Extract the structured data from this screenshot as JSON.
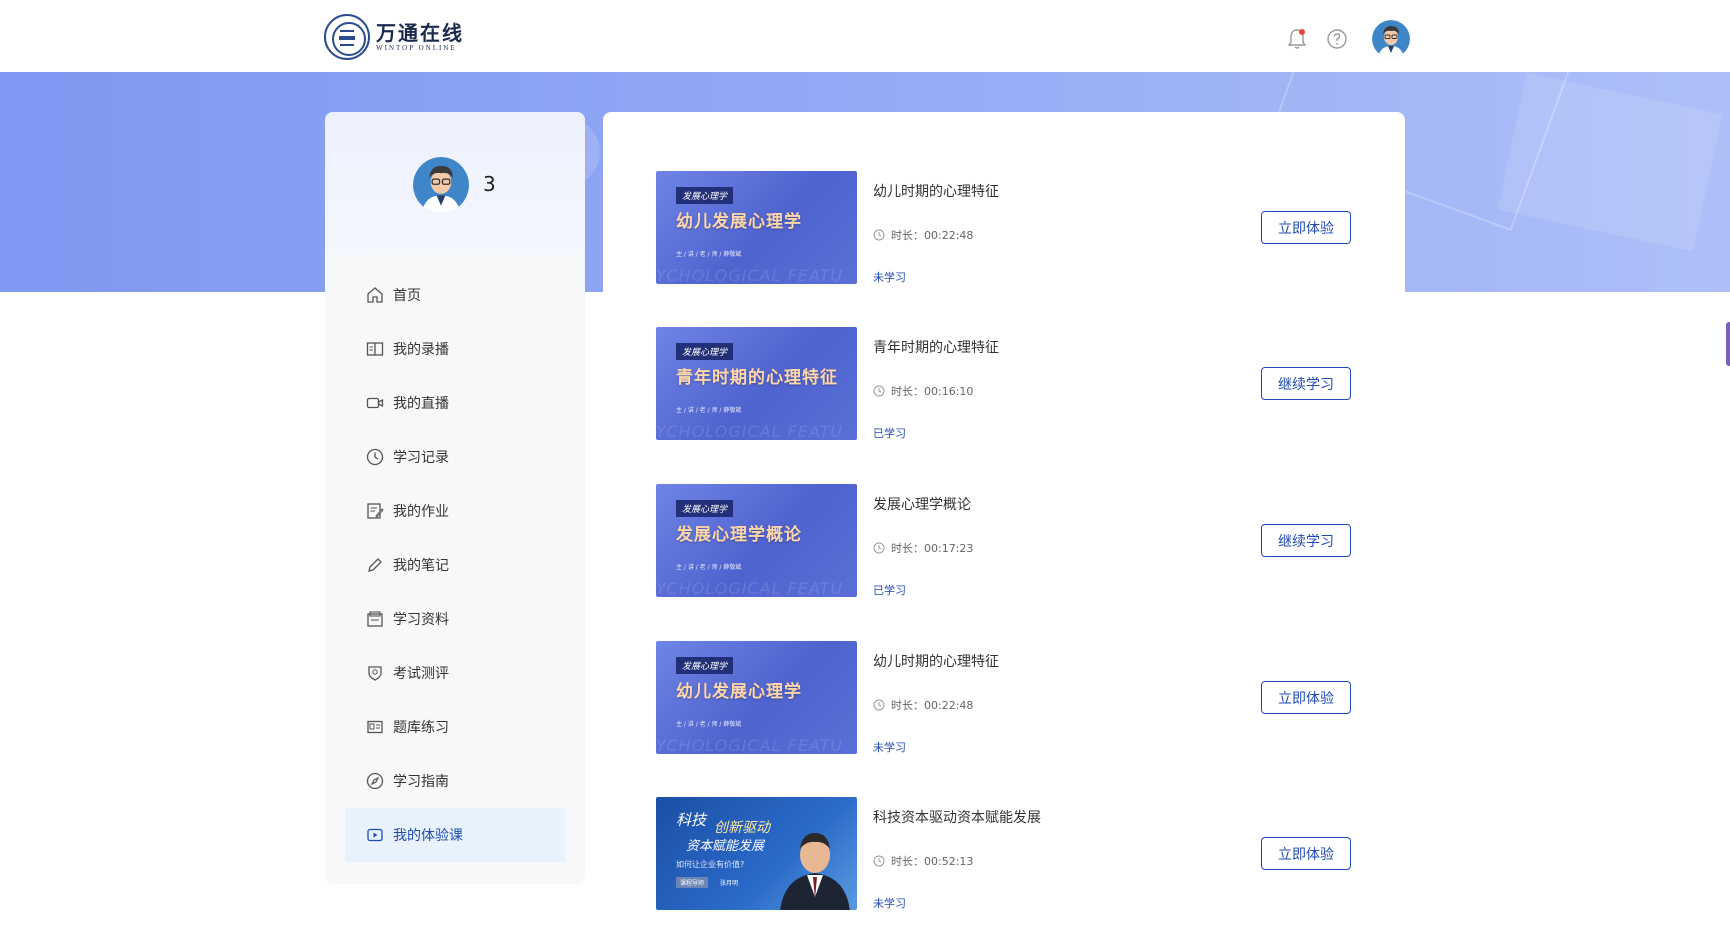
{
  "header": {
    "logo_cn": "万通在线",
    "logo_en": "WINTOP ONLINE",
    "icons": [
      "bell-icon",
      "help-icon",
      "avatar"
    ]
  },
  "profile": {
    "username": "3"
  },
  "sidebar": {
    "items": [
      {
        "label": "首页",
        "icon": "home-icon",
        "active": false
      },
      {
        "label": "我的录播",
        "icon": "book-icon",
        "active": false
      },
      {
        "label": "我的直播",
        "icon": "video-icon",
        "active": false
      },
      {
        "label": "学习记录",
        "icon": "clock-icon",
        "active": false
      },
      {
        "label": "我的作业",
        "icon": "edit-doc-icon",
        "active": false
      },
      {
        "label": "我的笔记",
        "icon": "pen-icon",
        "active": false
      },
      {
        "label": "学习资料",
        "icon": "folder-icon",
        "active": false
      },
      {
        "label": "考试测评",
        "icon": "badge-icon",
        "active": false
      },
      {
        "label": "题库练习",
        "icon": "id-card-icon",
        "active": false
      },
      {
        "label": "学习指南",
        "icon": "compass-icon",
        "active": false
      },
      {
        "label": "我的体验课",
        "icon": "play-box-icon",
        "active": true
      }
    ]
  },
  "courses": [
    {
      "title": "幼儿时期的心理特征",
      "duration": "时长：00:22:48",
      "status": "未学习",
      "button": "立即体验",
      "thumb": {
        "style": "purple",
        "tag": "发展心理学",
        "title": "幼儿发展心理学",
        "sub": "主 / 讲 / 老 / 师 / 薛敬斌",
        "wm": "YCHOLOGICAL FEATU"
      }
    },
    {
      "title": "青年时期的心理特征",
      "duration": "时长：00:16:10",
      "status": "已学习",
      "button": "继续学习",
      "thumb": {
        "style": "purple",
        "tag": "发展心理学",
        "title": "青年时期的心理特征",
        "sub": "主 / 讲 / 老 / 师 / 薛敬斌",
        "wm": "YCHOLOGICAL FEATU"
      }
    },
    {
      "title": "发展心理学概论",
      "duration": "时长：00:17:23",
      "status": "已学习",
      "button": "继续学习",
      "thumb": {
        "style": "purple",
        "tag": "发展心理学",
        "title": "发展心理学概论",
        "sub": "主 / 讲 / 老 / 师 / 薛敬斌",
        "wm": "YCHOLOGICAL FEATU"
      }
    },
    {
      "title": "幼儿时期的心理特征",
      "duration": "时长：00:22:48",
      "status": "未学习",
      "button": "立即体验",
      "thumb": {
        "style": "purple",
        "tag": "发展心理学",
        "title": "幼儿发展心理学",
        "sub": "主 / 讲 / 老 / 师 / 薛敬斌",
        "wm": "YCHOLOGICAL FEATU"
      }
    },
    {
      "title": "科技资本驱动资本赋能发展",
      "duration": "时长：00:52:13",
      "status": "未学习",
      "button": "立即体验",
      "thumb": {
        "style": "blue",
        "line1": "科技",
        "line1b": "创新驱动",
        "line2": "资本赋能发展",
        "question": "如何让企业有价值?",
        "badge": "课程导师",
        "name": "张月明"
      }
    }
  ],
  "colors": {
    "accent": "#1f4ab4",
    "banner": "#93aaf5",
    "active_bg": "#e8f2fd"
  }
}
